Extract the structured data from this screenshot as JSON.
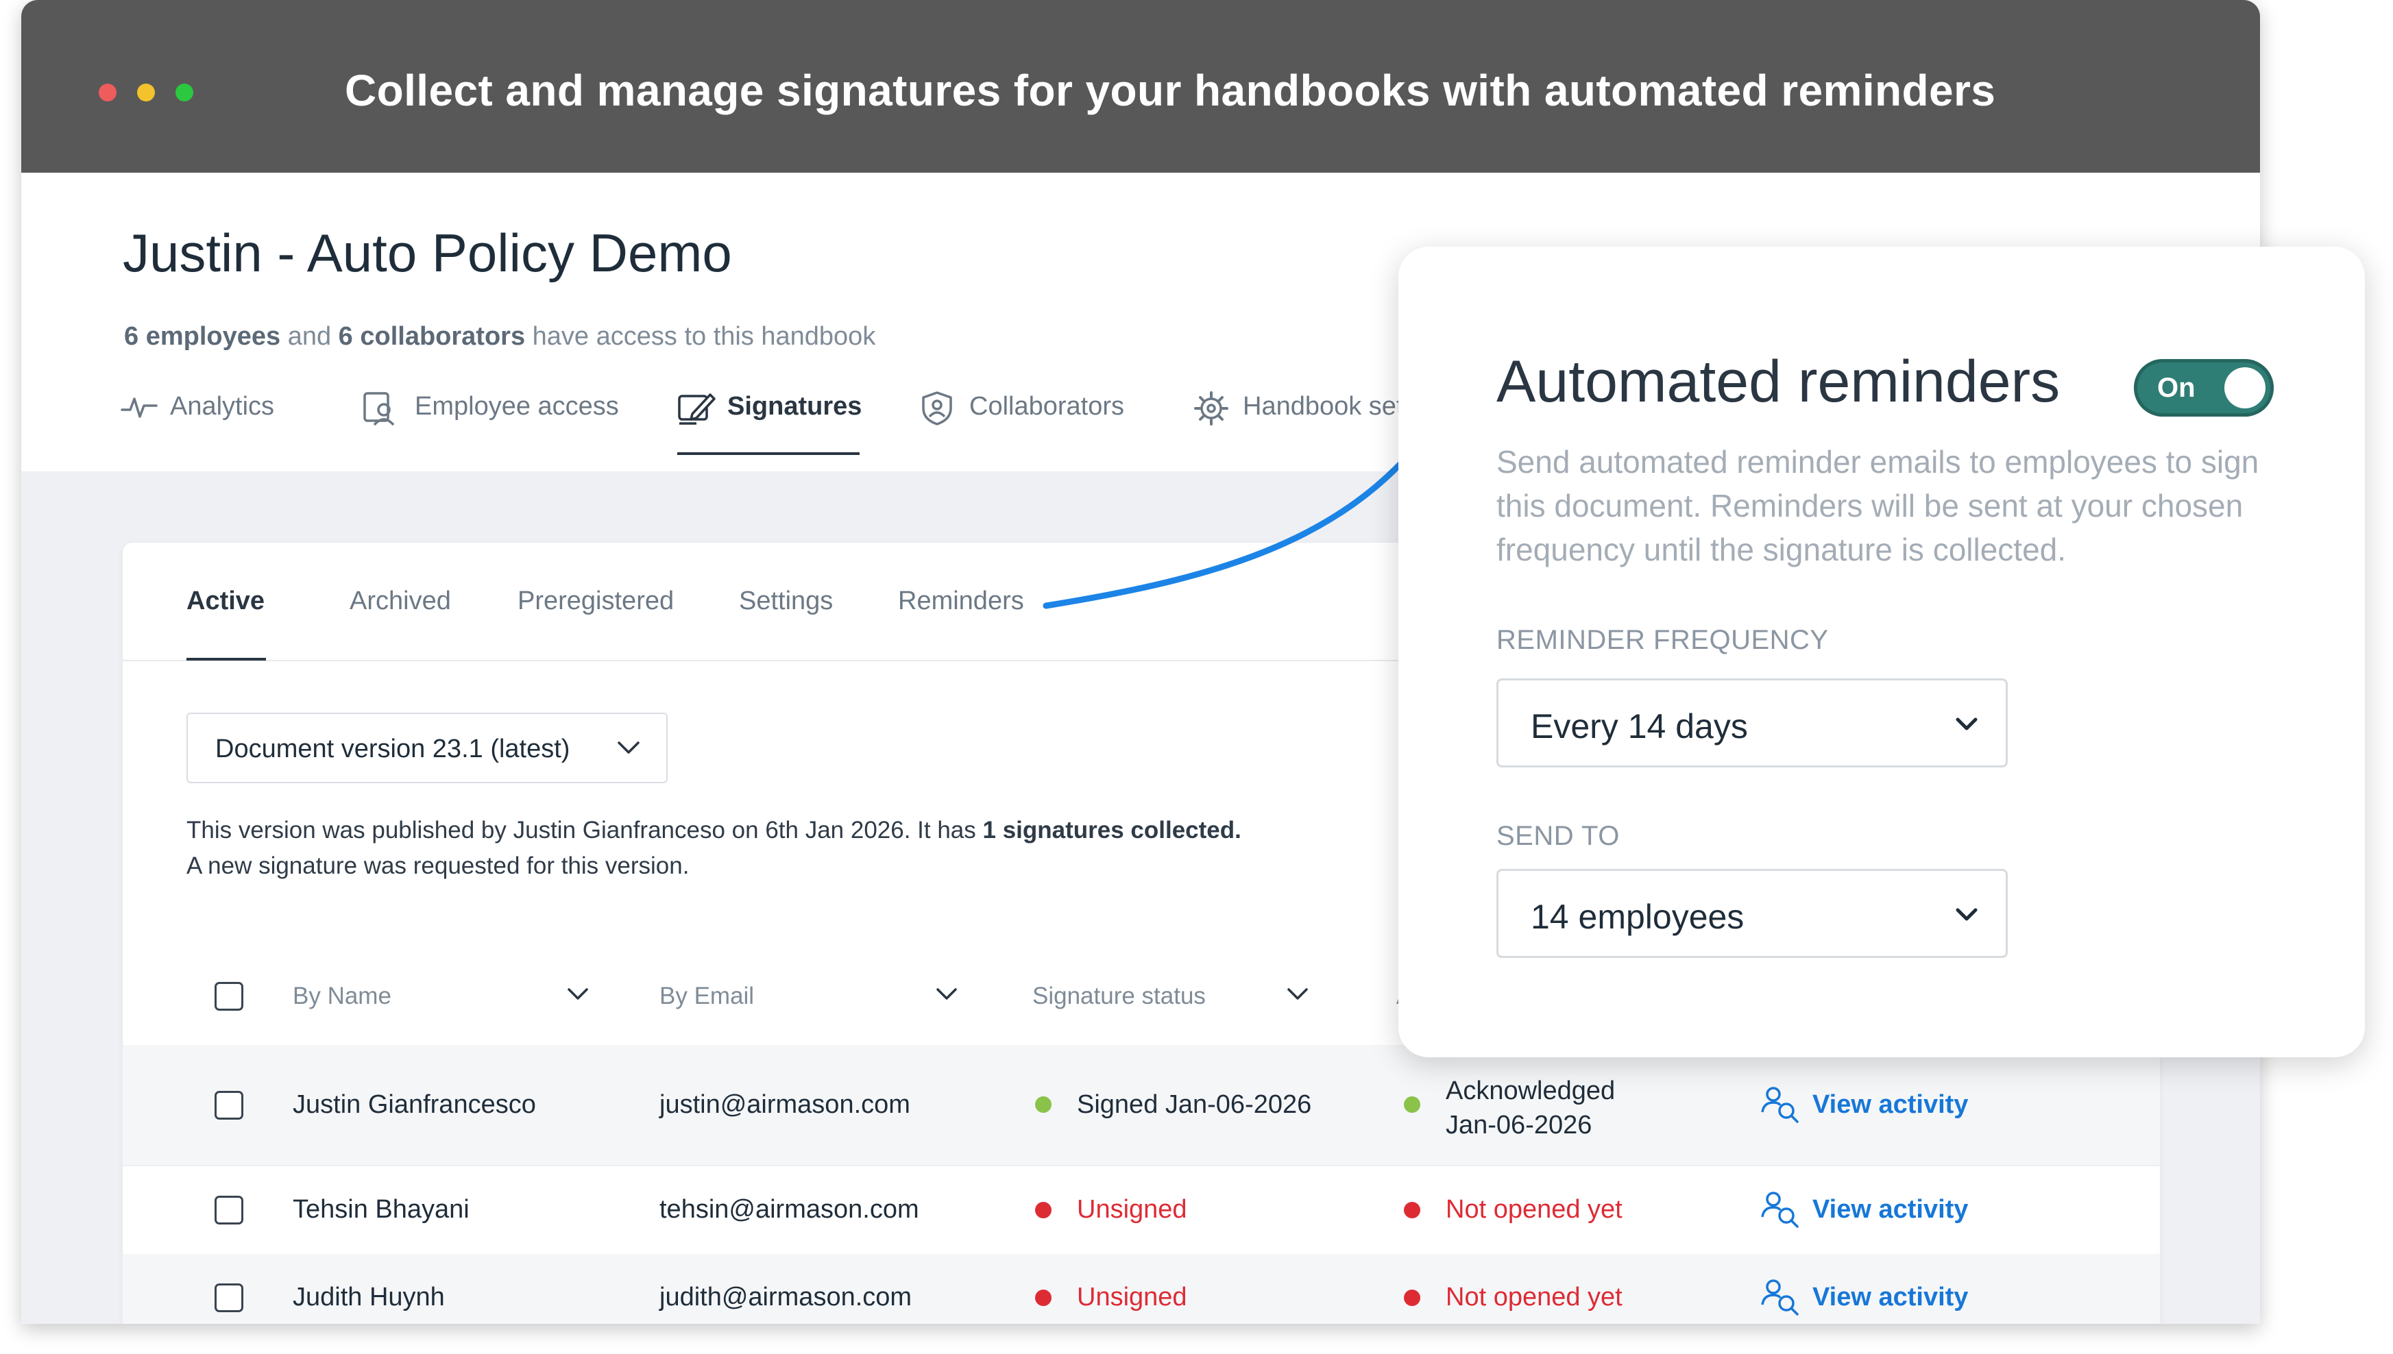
{
  "window": {
    "banner": "Collect and manage signatures for your handbooks with automated reminders",
    "dot_colors": [
      "#ee5c5c",
      "#f3c22c",
      "#2bc840"
    ]
  },
  "header": {
    "title": "Justin - Auto Policy Demo",
    "access_employees": "6 employees",
    "access_and": "and",
    "access_collaborators": "6 collaborators",
    "access_suffix": "have access to this handbook"
  },
  "main_tabs": [
    {
      "label": "Analytics",
      "icon": "analytics-icon"
    },
    {
      "label": "Employee access",
      "icon": "employee-access-icon"
    },
    {
      "label": "Signatures",
      "icon": "signature-icon",
      "active": true
    },
    {
      "label": "Collaborators",
      "icon": "collaborators-icon"
    },
    {
      "label": "Handbook sett",
      "icon": "gear-icon"
    }
  ],
  "sub_tabs": [
    {
      "label": "Active",
      "active": true
    },
    {
      "label": "Archived"
    },
    {
      "label": "Preregistered"
    },
    {
      "label": "Settings"
    },
    {
      "label": "Reminders"
    }
  ],
  "document_select": {
    "value": "Document version 23.1 (latest)"
  },
  "version_info": {
    "line1_prefix": "This version was published by Justin Gianfranceso on 6th Jan 2026. It has",
    "line1_bold": "1 signatures collected.",
    "line2": "A new signature was requested for this version."
  },
  "table": {
    "columns": [
      "By Name",
      "By Email",
      "Signature status",
      "Ac"
    ],
    "rows": [
      {
        "name": "Justin Gianfrancesco",
        "email": "justin@airmason.com",
        "signature": "Signed Jan-06-2026",
        "signature_color": "#8bc34a",
        "ack_line1": "Acknowledged",
        "ack_line2": "Jan-06-2026",
        "ack_color": "#8bc34a",
        "action": "View activity"
      },
      {
        "name": "Tehsin Bhayani",
        "email": "tehsin@airmason.com",
        "signature": "Unsigned",
        "signature_color": "#dd2b34",
        "ack_line1": "Not opened yet",
        "ack_line2": "",
        "ack_color": "#dd2b34",
        "action": "View activity"
      },
      {
        "name": "Judith Huynh",
        "email": "judith@airmason.com",
        "signature": "Unsigned",
        "signature_color": "#dd2b34",
        "ack_line1": "Not opened yet",
        "ack_line2": "",
        "ack_color": "#dd2b34",
        "action": "View activity"
      }
    ]
  },
  "reminders_panel": {
    "title": "Automated reminders",
    "toggle_label": "On",
    "description": "Send automated reminder emails to employees to sign this document. Reminders will be sent at your chosen frequency until the signature is collected.",
    "frequency_label": "REMINDER FREQUENCY",
    "frequency_value": "Every 14 days",
    "send_to_label": "SEND TO",
    "send_to_value": "14 employees"
  },
  "colors": {
    "accent_link": "#1777d8",
    "toggle_green": "#2f7e75",
    "connector_blue": "#1c84e6",
    "status_red": "#dd2b34",
    "status_green": "#8bc34a"
  }
}
